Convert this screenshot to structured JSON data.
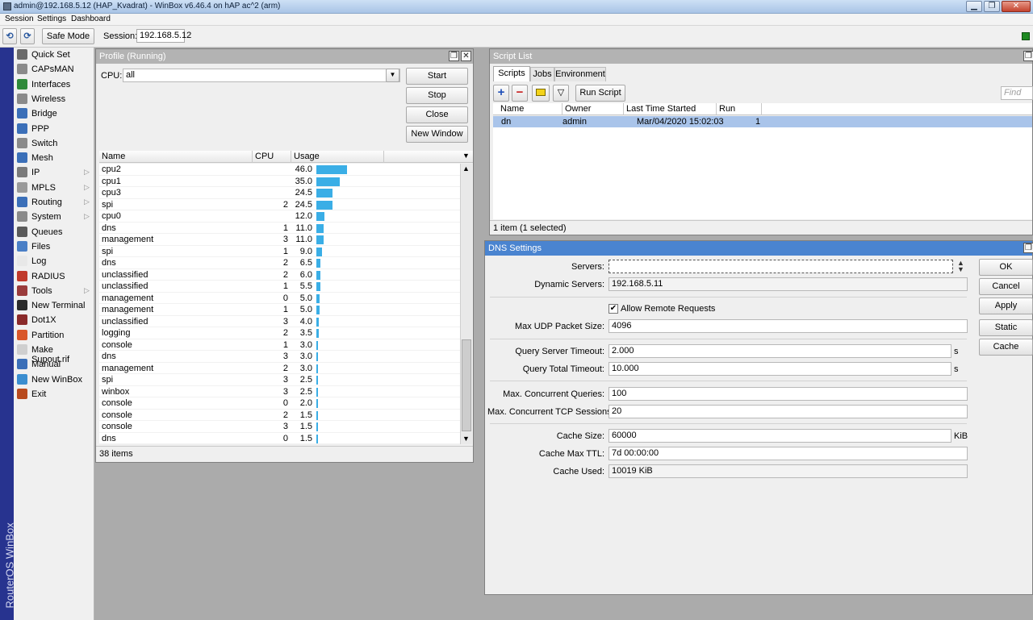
{
  "window": {
    "title": "admin@192.168.5.12 (HAP_Kvadrat) - WinBox v6.46.4 on hAP ac^2 (arm)",
    "controls": {
      "minimize": "▁",
      "maximize": "❐",
      "close": "✕"
    }
  },
  "menu": [
    "Session",
    "Settings",
    "Dashboard"
  ],
  "toolbar": {
    "undo_icon": "⟲",
    "redo_icon": "⟳",
    "safe_mode_label": "Safe Mode",
    "session_label": "Session:",
    "session_value": "192.168.5.12",
    "status_color": "#1e8a22"
  },
  "sidebar": {
    "brand": "RouterOS WinBox",
    "items": [
      {
        "label": "Quick Set",
        "icon": "quickset-icon",
        "color": "#6a6a6a",
        "submenu": false
      },
      {
        "label": "CAPsMAN",
        "icon": "capsman-icon",
        "color": "#8a8a8a",
        "submenu": false
      },
      {
        "label": "Interfaces",
        "icon": "interfaces-icon",
        "color": "#2f8a3a",
        "submenu": false
      },
      {
        "label": "Wireless",
        "icon": "wireless-icon",
        "color": "#8a8a8a",
        "submenu": false
      },
      {
        "label": "Bridge",
        "icon": "bridge-icon",
        "color": "#3b6fb8",
        "submenu": false
      },
      {
        "label": "PPP",
        "icon": "ppp-icon",
        "color": "#3b6fb8",
        "submenu": false
      },
      {
        "label": "Switch",
        "icon": "switch-icon",
        "color": "#8a8a8a",
        "submenu": false
      },
      {
        "label": "Mesh",
        "icon": "mesh-icon",
        "color": "#3b6fb8",
        "submenu": false
      },
      {
        "label": "IP",
        "icon": "ip-icon",
        "color": "#7a7a7a",
        "submenu": true
      },
      {
        "label": "MPLS",
        "icon": "mpls-icon",
        "color": "#9a9a9a",
        "submenu": true
      },
      {
        "label": "Routing",
        "icon": "routing-icon",
        "color": "#3b6fb8",
        "submenu": true
      },
      {
        "label": "System",
        "icon": "system-icon",
        "color": "#8a8a8a",
        "submenu": true
      },
      {
        "label": "Queues",
        "icon": "queues-icon",
        "color": "#5a5a5a",
        "submenu": false
      },
      {
        "label": "Files",
        "icon": "files-icon",
        "color": "#4a7fc6",
        "submenu": false
      },
      {
        "label": "Log",
        "icon": "log-icon",
        "color": "#e8e8e8",
        "submenu": false
      },
      {
        "label": "RADIUS",
        "icon": "radius-icon",
        "color": "#c0392b",
        "submenu": false
      },
      {
        "label": "Tools",
        "icon": "tools-icon",
        "color": "#9a3b3b",
        "submenu": true
      },
      {
        "label": "New Terminal",
        "icon": "terminal-icon",
        "color": "#2b2b2b",
        "submenu": false
      },
      {
        "label": "Dot1X",
        "icon": "dot1x-icon",
        "color": "#8a2a2a",
        "submenu": false
      },
      {
        "label": "Partition",
        "icon": "partition-icon",
        "color": "#d9572a",
        "submenu": false
      },
      {
        "label": "Make Supout.rif",
        "icon": "supout-icon",
        "color": "#cfcfcf",
        "submenu": false
      },
      {
        "label": "Manual",
        "icon": "manual-icon",
        "color": "#3b6fb8",
        "submenu": false
      },
      {
        "label": "New WinBox",
        "icon": "winbox-icon",
        "color": "#3b8ed0",
        "submenu": false
      },
      {
        "label": "Exit",
        "icon": "exit-icon",
        "color": "#b84a1e",
        "submenu": false
      }
    ]
  },
  "profile": {
    "title": "Profile (Running)",
    "cpu_label": "CPU:",
    "cpu_value": "all",
    "buttons": {
      "start": "Start",
      "stop": "Stop",
      "close": "Close",
      "new_window": "New Window"
    },
    "columns": {
      "name": "Name",
      "cpu": "CPU",
      "usage": "Usage"
    },
    "rows": [
      {
        "name": "cpu2",
        "cpu": "",
        "usage": "46.0"
      },
      {
        "name": "cpu1",
        "cpu": "",
        "usage": "35.0"
      },
      {
        "name": "cpu3",
        "cpu": "",
        "usage": "24.5"
      },
      {
        "name": "spi",
        "cpu": "2",
        "usage": "24.5"
      },
      {
        "name": "cpu0",
        "cpu": "",
        "usage": "12.0"
      },
      {
        "name": "dns",
        "cpu": "1",
        "usage": "11.0"
      },
      {
        "name": "management",
        "cpu": "3",
        "usage": "11.0"
      },
      {
        "name": "spi",
        "cpu": "1",
        "usage": "9.0"
      },
      {
        "name": "dns",
        "cpu": "2",
        "usage": "6.5"
      },
      {
        "name": "unclassified",
        "cpu": "2",
        "usage": "6.0"
      },
      {
        "name": "unclassified",
        "cpu": "1",
        "usage": "5.5"
      },
      {
        "name": "management",
        "cpu": "0",
        "usage": "5.0"
      },
      {
        "name": "management",
        "cpu": "1",
        "usage": "5.0"
      },
      {
        "name": "unclassified",
        "cpu": "3",
        "usage": "4.0"
      },
      {
        "name": "logging",
        "cpu": "2",
        "usage": "3.5"
      },
      {
        "name": "console",
        "cpu": "1",
        "usage": "3.0"
      },
      {
        "name": "dns",
        "cpu": "3",
        "usage": "3.0"
      },
      {
        "name": "management",
        "cpu": "2",
        "usage": "3.0"
      },
      {
        "name": "spi",
        "cpu": "3",
        "usage": "2.5"
      },
      {
        "name": "winbox",
        "cpu": "3",
        "usage": "2.5"
      },
      {
        "name": "console",
        "cpu": "0",
        "usage": "2.0"
      },
      {
        "name": "console",
        "cpu": "2",
        "usage": "1.5"
      },
      {
        "name": "console",
        "cpu": "3",
        "usage": "1.5"
      },
      {
        "name": "dns",
        "cpu": "0",
        "usage": "1.5"
      }
    ],
    "status": "38 items"
  },
  "scripts": {
    "title": "Script List",
    "tabs": [
      "Scripts",
      "Jobs",
      "Environment"
    ],
    "run_script_label": "Run Script",
    "find_placeholder": "Find",
    "columns": {
      "name": "Name",
      "owner": "Owner",
      "last_started": "Last Time Started",
      "run_count": "Run Count"
    },
    "rows": [
      {
        "name": "dn",
        "owner": "admin",
        "last_started": "Mar/04/2020 15:02:03",
        "run_count": "1"
      }
    ],
    "status": "1 item (1 selected)"
  },
  "dns": {
    "title": "DNS Settings",
    "servers_label": "Servers:",
    "servers_value": "",
    "dynamic_servers_label": "Dynamic Servers:",
    "dynamic_servers_value": "192.168.5.11",
    "allow_remote_label": "Allow Remote Requests",
    "allow_remote_checked": true,
    "max_udp_label": "Max UDP Packet Size:",
    "max_udp_value": "4096",
    "query_server_timeout_label": "Query Server Timeout:",
    "query_server_timeout_value": "2.000",
    "query_total_timeout_label": "Query Total Timeout:",
    "query_total_timeout_value": "10.000",
    "seconds_unit": "s",
    "max_concurrent_queries_label": "Max. Concurrent Queries:",
    "max_concurrent_queries_value": "100",
    "max_concurrent_tcp_label": "Max. Concurrent TCP Sessions:",
    "max_concurrent_tcp_value": "20",
    "cache_size_label": "Cache Size:",
    "cache_size_value": "60000",
    "cache_size_unit": "KiB",
    "cache_max_ttl_label": "Cache Max TTL:",
    "cache_max_ttl_value": "7d 00:00:00",
    "cache_used_label": "Cache Used:",
    "cache_used_value": "10019 KiB",
    "buttons": {
      "ok": "OK",
      "cancel": "Cancel",
      "apply": "Apply",
      "static": "Static",
      "cache": "Cache"
    }
  }
}
